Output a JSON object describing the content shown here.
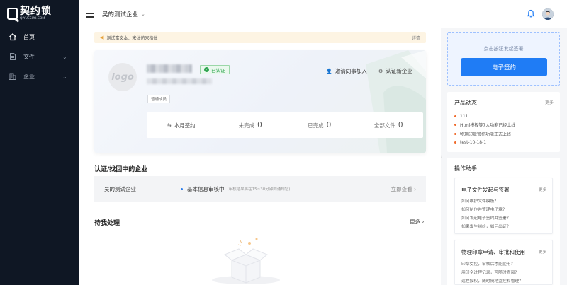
{
  "sidebar": {
    "logo_text": "契约锁",
    "logo_sub": "QIYUESUO.COM",
    "items": [
      {
        "label": "首页",
        "icon": "home-icon",
        "active": true
      },
      {
        "label": "文件",
        "icon": "file-icon"
      },
      {
        "label": "企业",
        "icon": "building-icon"
      }
    ]
  },
  "header": {
    "company": "吴的测试企业",
    "icons": [
      "menu-toggle-icon",
      "bell-icon",
      "avatar"
    ]
  },
  "notice": {
    "text": "测试富文本：宋体仿宋楷体",
    "detail": "详情"
  },
  "company_card": {
    "logo_placeholder": "logo",
    "verified": "已认证",
    "member_tag": "普通成员",
    "invite": "邀请同事加入",
    "certify": "认证新企业",
    "stats": [
      {
        "label": "本月签约",
        "value": ""
      },
      {
        "label": "未完成",
        "value": "0"
      },
      {
        "label": "已完成",
        "value": "0"
      },
      {
        "label": "全部文件",
        "value": "0"
      }
    ]
  },
  "cert_section": {
    "title": "认证/找回中的企业",
    "company": "吴的测试企业",
    "status": "基本信息审核中",
    "hint": "(审核结果将在15~30分钟内通知您)",
    "link": "立即查看 ›"
  },
  "todo_section": {
    "title": "待我处理",
    "more": "更多 ›"
  },
  "right_panel": {
    "sign_hint": "点击按钮发起签署",
    "sign_button": "电子签约",
    "news": {
      "title": "产品动态",
      "more": "更多",
      "items": [
        "111",
        "Html模板等7大功能已经上线",
        "物理印章管控功能正式上线",
        "test-10-18-1"
      ]
    },
    "help": {
      "title": "操作助手",
      "sections": [
        {
          "title": "电子文件发起与签署",
          "more": "更多",
          "items": [
            "如何维护文件模板?",
            "如何制作并管理电子章?",
            "如何发起电子签约并签署?",
            "如果发生纠纷，如何出证?"
          ]
        },
        {
          "title": "物理印章申请、审批和使用",
          "more": "更多",
          "items": [
            "印章受控，审核后才能使用?",
            "用印全过程记录，可随时查阅?",
            "远程授权，随时随地监控和管理?"
          ]
        }
      ]
    }
  },
  "colors": {
    "sidebar_bg": "#0f1724",
    "primary": "#1f7cf5",
    "verified": "#2ea44f",
    "news_dot": "#f06a2a"
  }
}
